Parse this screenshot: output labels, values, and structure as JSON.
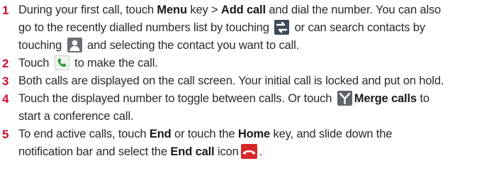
{
  "steps": [
    {
      "number": "1",
      "l1a": "During your first call, touch ",
      "l1b": "Menu",
      "l1c": " key > ",
      "l1d": "Add call",
      "l1e": " and dial the number. You can also",
      "l2a": "go to the recently dialled numbers list by touching ",
      "l2b": " or can search contacts by",
      "l3a": "touching ",
      "l3b": " and selecting the contact you want to call."
    },
    {
      "number": "2",
      "a": "Touch ",
      "b": " to make the call."
    },
    {
      "number": "3",
      "a": "Both calls are displayed on the call screen. Your initial call is locked and put on hold."
    },
    {
      "number": "4",
      "l1a": "Touch the displayed number to toggle between calls. Or touch ",
      "l1b": "Merge calls",
      "l1c": " to",
      "l2a": "start a conference call."
    },
    {
      "number": "5",
      "l1a": "To end active calls, touch ",
      "l1b": "End",
      "l1c": " or touch the ",
      "l1d": "Home",
      "l1e": " key, and slide down the",
      "l2a": "notification bar and select the ",
      "l2b": "End call",
      "l2c": " icon",
      "l2d": "."
    }
  ],
  "icons": {
    "recent": "recent-calls-icon",
    "contacts": "contacts-icon",
    "call": "call-icon",
    "merge": "merge-calls-icon",
    "end": "end-call-icon"
  },
  "colors": {
    "number": "#c8102e",
    "text": "#2a2a2a",
    "end_call": "#d62828",
    "call_green": "#2e9a3e"
  }
}
